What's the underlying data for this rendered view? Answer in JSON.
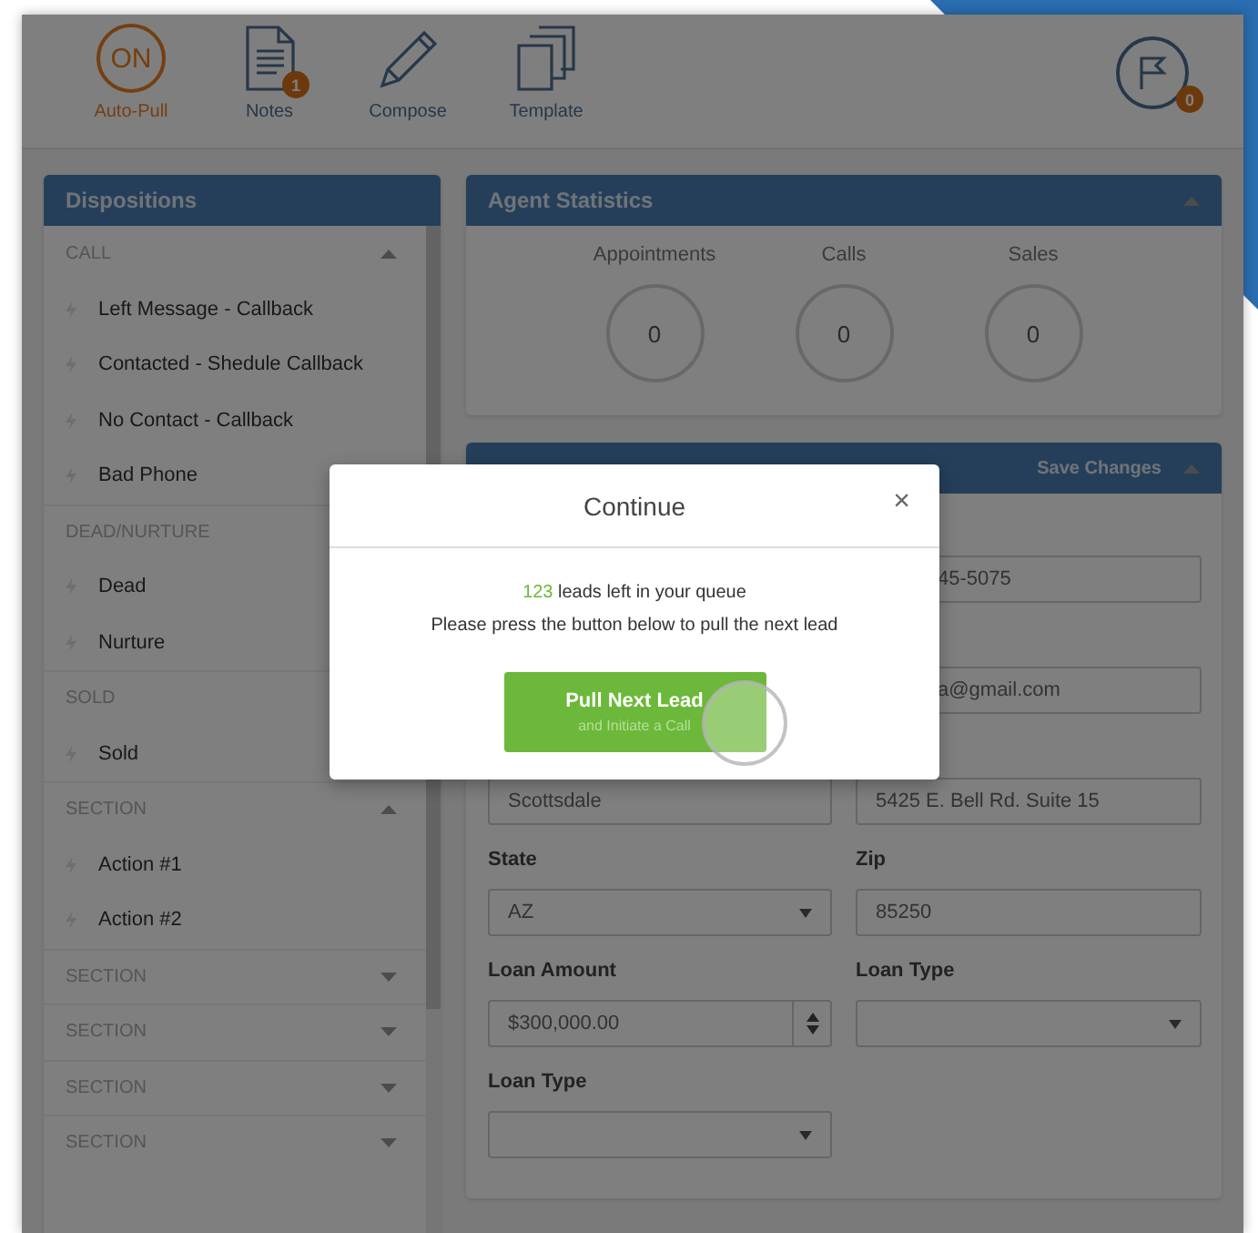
{
  "toolbar": {
    "items": [
      {
        "kind": "toggle",
        "label": "Auto-Pull",
        "text": "ON",
        "on": true
      },
      {
        "kind": "notes",
        "label": "Notes",
        "badge": "1"
      },
      {
        "kind": "compose",
        "label": "Compose"
      },
      {
        "kind": "template",
        "label": "Template"
      }
    ],
    "flag_badge": "0"
  },
  "dispositions": {
    "title": "Dispositions",
    "groups": [
      {
        "title": "CALL",
        "expanded": true,
        "items": [
          "Left Message - Callback",
          "Contacted - Shedule Callback",
          "No Contact - Callback",
          "Bad Phone"
        ]
      },
      {
        "title": "DEAD/NURTURE",
        "items": [
          "Dead",
          "Nurture"
        ]
      },
      {
        "title": "SOLD",
        "items": [
          "Sold"
        ]
      },
      {
        "title": "SECTION",
        "expanded": true,
        "items": [
          "Action #1",
          "Action #2"
        ]
      },
      {
        "title": "SECTION",
        "expanded": false
      },
      {
        "title": "SECTION",
        "expanded": false
      },
      {
        "title": "SECTION",
        "expanded": false
      },
      {
        "title": "SECTION",
        "expanded": false
      }
    ]
  },
  "agent_statistics": {
    "title": "Agent Statistics",
    "stats": [
      {
        "label": "Appointments",
        "value": "0"
      },
      {
        "label": "Calls",
        "value": "0"
      },
      {
        "label": "Sales",
        "value": "0"
      }
    ]
  },
  "standard_details": {
    "action": "Save Changes",
    "rows": [
      {
        "right": {
          "kind": "text",
          "value": "45-5075",
          "partial": true
        }
      },
      {
        "right": {
          "kind": "text",
          "value": "a@gmail.com",
          "partial": true
        }
      },
      {
        "left": {
          "kind": "text",
          "value": "Scottsdale"
        },
        "right": {
          "kind": "text",
          "value": "5425 E. Bell Rd. Suite 15"
        }
      },
      {
        "left": {
          "label": "State",
          "kind": "select",
          "value": "AZ"
        },
        "right": {
          "label": "Zip",
          "kind": "text",
          "value": "85250"
        }
      },
      {
        "left": {
          "label": "Loan Amount",
          "kind": "number",
          "value": "$300,000.00"
        },
        "right": {
          "label": "Loan Type",
          "kind": "select"
        }
      },
      {
        "left": {
          "label": "Loan Type",
          "kind": "select"
        }
      }
    ]
  },
  "modal": {
    "title": "Continue",
    "close": "×",
    "count": "123",
    "queue_text": " leads left in your queue",
    "instruction": "Please press the button below to pull the next lead",
    "button": {
      "label": "Pull Next Lead",
      "sublabel": "and Initiate a Call"
    }
  }
}
